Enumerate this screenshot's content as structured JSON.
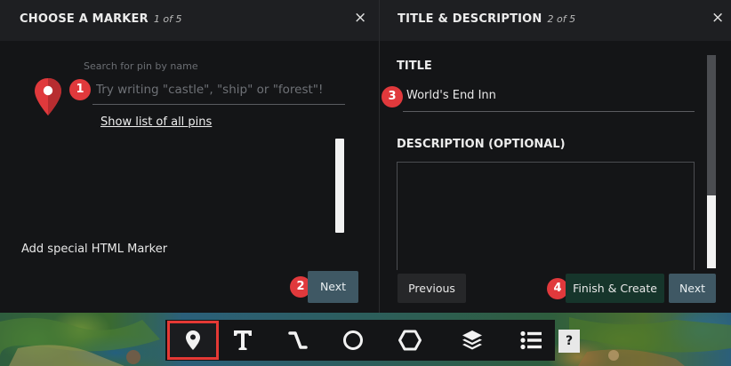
{
  "left_panel": {
    "title": "CHOOSE A MARKER",
    "step": "1 of 5",
    "close_label": "×",
    "search_label": "Search for pin by name",
    "search_placeholder": "Try writing \"castle\", \"ship\" or \"forest\"!",
    "show_list_link": "Show list of all pins",
    "html_marker_label": "Add special HTML Marker",
    "next_label": "Next",
    "pin_color": "#e0393c"
  },
  "right_panel": {
    "title": "TITLE & DESCRIPTION",
    "step": "2 of 5",
    "close_label": "×",
    "title_label": "TITLE",
    "title_value": "World's End Inn",
    "description_label": "DESCRIPTION (OPTIONAL)",
    "description_value": "",
    "previous_label": "Previous",
    "finish_label": "Finish & Create",
    "next_label": "Next"
  },
  "badges": [
    "1",
    "2",
    "3",
    "4"
  ],
  "toolbar": {
    "tools": [
      {
        "name": "marker",
        "icon": "map-pin-icon",
        "selected": true
      },
      {
        "name": "text",
        "icon": "text-icon",
        "selected": false
      },
      {
        "name": "path",
        "icon": "path-icon",
        "selected": false
      },
      {
        "name": "circle",
        "icon": "circle-icon",
        "selected": false
      },
      {
        "name": "polygon",
        "icon": "polygon-icon",
        "selected": false
      },
      {
        "name": "layers",
        "icon": "layers-icon",
        "selected": false
      },
      {
        "name": "list",
        "icon": "list-icon",
        "selected": false
      }
    ],
    "help_label": "?"
  },
  "colors": {
    "accent_red": "#e0393c",
    "selected_outline": "#e53935",
    "next_button": "#3f5864",
    "finish_button": "#16352b"
  }
}
